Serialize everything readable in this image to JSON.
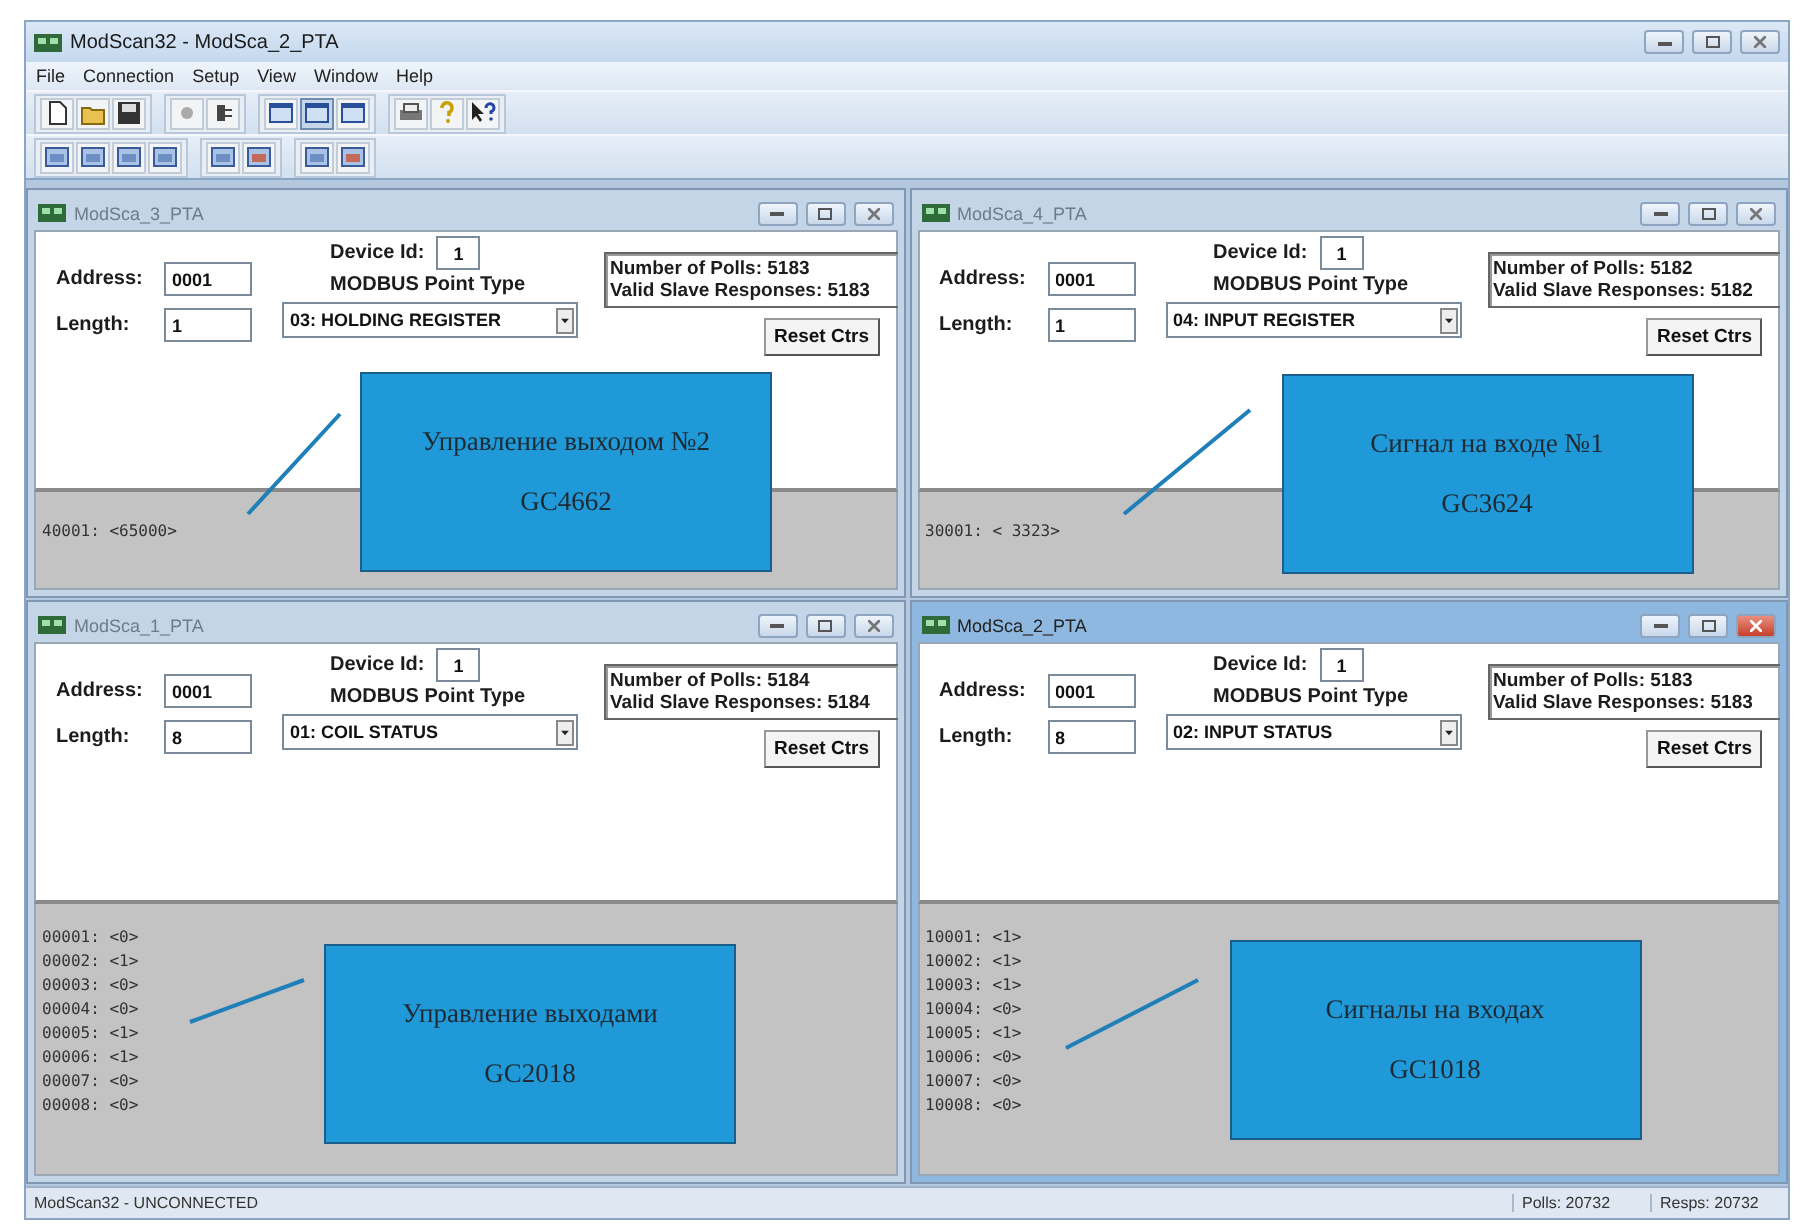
{
  "window": {
    "title": "ModScan32 - ModSca_2_PTA"
  },
  "menu": [
    "File",
    "Connection",
    "Setup",
    "View",
    "Window",
    "Help"
  ],
  "documents": [
    {
      "title": "ModSca_3_PTA",
      "active": false,
      "address_label": "Address:",
      "address": "0001",
      "length_label": "Length:",
      "length": "1",
      "device_label": "Device Id:",
      "device_id": "1",
      "type_label": "MODBUS Point Type",
      "point_type": "03: HOLDING REGISTER",
      "polls": "Number of Polls: 5183",
      "responses": "Valid Slave Responses: 5183",
      "reset": "Reset Ctrs",
      "values": [
        "40001: <65000>"
      ],
      "callout": [
        "Управление выходом №2",
        "GC4662"
      ]
    },
    {
      "title": "ModSca_4_PTA",
      "active": false,
      "address_label": "Address:",
      "address": "0001",
      "length_label": "Length:",
      "length": "1",
      "device_label": "Device Id:",
      "device_id": "1",
      "type_label": "MODBUS Point Type",
      "point_type": "04: INPUT REGISTER",
      "polls": "Number of Polls: 5182",
      "responses": "Valid Slave Responses: 5182",
      "reset": "Reset Ctrs",
      "values": [
        "30001: < 3323>"
      ],
      "callout": [
        "Сигнал на входе №1",
        "GC3624"
      ]
    },
    {
      "title": "ModSca_1_PTA",
      "active": false,
      "address_label": "Address:",
      "address": "0001",
      "length_label": "Length:",
      "length": "8",
      "device_label": "Device Id:",
      "device_id": "1",
      "type_label": "MODBUS Point Type",
      "point_type": "01: COIL STATUS",
      "polls": "Number of Polls: 5184",
      "responses": "Valid Slave Responses: 5184",
      "reset": "Reset Ctrs",
      "values": [
        "00001: <0>",
        "00002: <1>",
        "00003: <0>",
        "00004: <0>",
        "00005: <1>",
        "00006: <1>",
        "00007: <0>",
        "00008: <0>"
      ],
      "callout": [
        "Управление выходами",
        "GC2018"
      ]
    },
    {
      "title": "ModSca_2_PTA",
      "active": true,
      "address_label": "Address:",
      "address": "0001",
      "length_label": "Length:",
      "length": "8",
      "device_label": "Device Id:",
      "device_id": "1",
      "type_label": "MODBUS Point Type",
      "point_type": "02: INPUT STATUS",
      "polls": "Number of Polls: 5183",
      "responses": "Valid Slave Responses: 5183",
      "reset": "Reset Ctrs",
      "values": [
        "10001: <1>",
        "10002: <1>",
        "10003: <1>",
        "10004: <0>",
        "10005: <1>",
        "10006: <0>",
        "10007: <0>",
        "10008: <0>"
      ],
      "callout": [
        "Сигналы на входах",
        "GC1018"
      ]
    }
  ],
  "status_bar": {
    "text": "ModScan32 - UNCONNECTED",
    "polls": "Polls: 20732",
    "resps": "Resps: 20732"
  }
}
